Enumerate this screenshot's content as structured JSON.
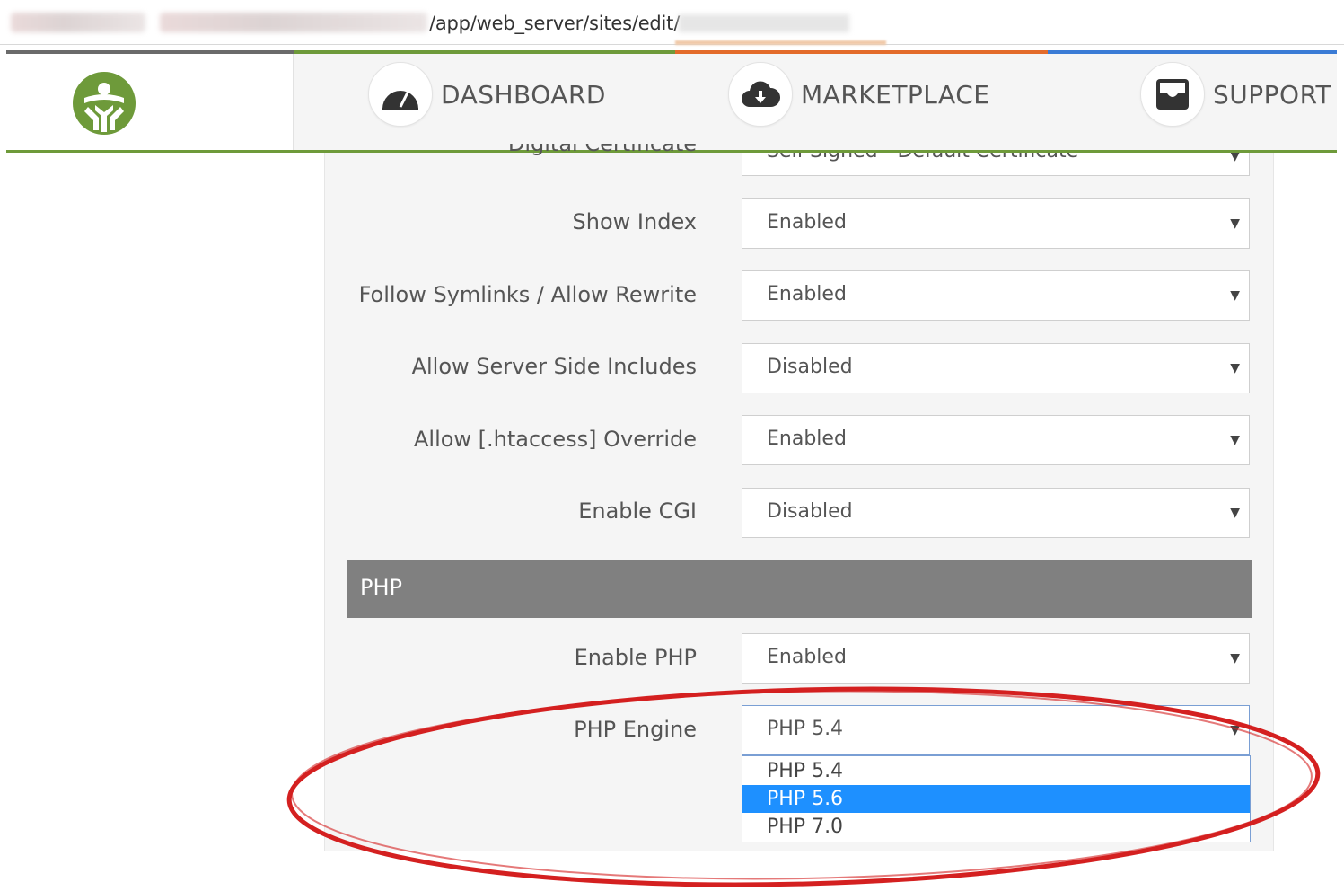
{
  "browser": {
    "url_visible": "/app/web_server/sites/edit/"
  },
  "nav": {
    "items": [
      {
        "label": "DASHBOARD",
        "icon": "speedometer-icon"
      },
      {
        "label": "MARKETPLACE",
        "icon": "cloud-download-icon"
      },
      {
        "label": "SUPPORT",
        "icon": "inbox-icon"
      }
    ],
    "accent_color": "#6e9a3a"
  },
  "form": {
    "partial_row": {
      "label": "Digital Certificate",
      "value": "Self-Signed - Default Certificate"
    },
    "rows": [
      {
        "label": "Show Index",
        "value": "Enabled"
      },
      {
        "label": "Follow Symlinks / Allow Rewrite",
        "value": "Enabled"
      },
      {
        "label": "Allow Server Side Includes",
        "value": "Disabled"
      },
      {
        "label": "Allow [.htaccess] Override",
        "value": "Enabled"
      },
      {
        "label": "Enable CGI",
        "value": "Disabled"
      }
    ],
    "php_section": {
      "title": "PHP",
      "enable_php": {
        "label": "Enable PHP",
        "value": "Enabled"
      },
      "php_engine": {
        "label": "PHP Engine",
        "value": "PHP 5.4",
        "options": [
          "PHP 5.4",
          "PHP 5.6",
          "PHP 7.0"
        ],
        "highlighted_option": "PHP 5.6"
      }
    }
  },
  "colors": {
    "section_bg": "#808080",
    "highlight": "#1e90ff",
    "annotation": "#d42020"
  }
}
